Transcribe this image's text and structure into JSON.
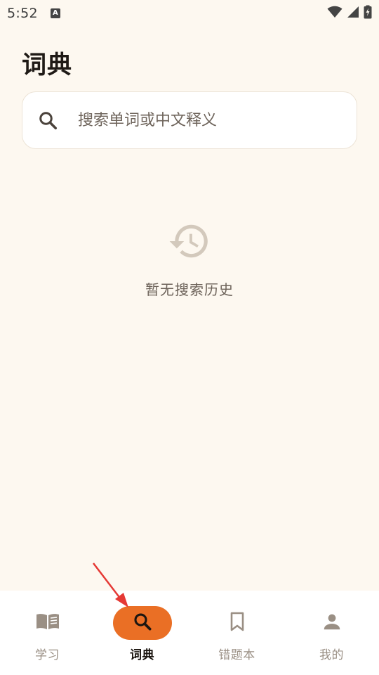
{
  "status_bar": {
    "time": "5:52",
    "input_badge": "A",
    "icons": [
      "wifi-icon",
      "cellular-signal-icon",
      "battery-charging-icon"
    ]
  },
  "header": {
    "title": "词典"
  },
  "search": {
    "placeholder": "搜索单词或中文释义",
    "value": ""
  },
  "empty_state": {
    "icon": "history-icon",
    "message": "暂无搜索历史"
  },
  "bottom_nav": {
    "items": [
      {
        "label": "学习",
        "icon": "book-icon",
        "active": false
      },
      {
        "label": "词典",
        "icon": "search-icon",
        "active": true
      },
      {
        "label": "错题本",
        "icon": "bookmark-icon",
        "active": false
      },
      {
        "label": "我的",
        "icon": "person-icon",
        "active": false
      }
    ]
  },
  "colors": {
    "background": "#fdf8f0",
    "accent": "#ea6f25",
    "nav_inactive": "#9a8f84",
    "annotation_arrow": "#e53935"
  }
}
